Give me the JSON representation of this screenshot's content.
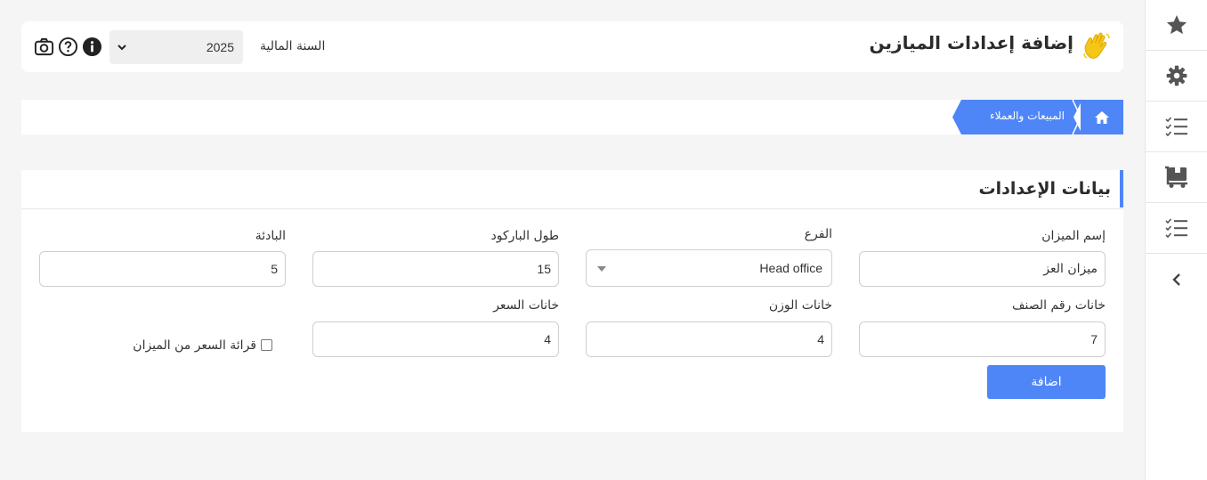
{
  "header": {
    "title": "إضافة إعدادات الميازين",
    "fiscal_year_label": "السنة المالية",
    "fiscal_year_value": "2025"
  },
  "breadcrumb": {
    "home_icon": "home-icon",
    "items": [
      "المبيعات والعملاء"
    ]
  },
  "sidebar": {
    "items": [
      {
        "icon": "star-icon"
      },
      {
        "icon": "gear-icon"
      },
      {
        "icon": "checklist-icon"
      },
      {
        "icon": "truck-icon"
      },
      {
        "icon": "checklist-icon"
      },
      {
        "icon": "chevron-left-icon"
      }
    ]
  },
  "form": {
    "section_title": "بيانات الإعدادات",
    "scale_name_label": "إسم الميزان",
    "scale_name_value": "ميزان العز",
    "branch_label": "الفرع",
    "branch_value": "Head office",
    "barcode_length_label": "طول الباركود",
    "barcode_length_value": "15",
    "prefix_label": "البادئة",
    "prefix_value": "5",
    "item_digits_label": "خانات رقم الصنف",
    "item_digits_value": "7",
    "weight_digits_label": "خانات الوزن",
    "weight_digits_value": "4",
    "price_digits_label": "خانات السعر",
    "price_digits_value": "4",
    "read_price_label": "قرائة السعر من الميزان",
    "read_price_checked": false,
    "submit_label": "اضافة"
  },
  "colors": {
    "accent": "#4f86f7",
    "background": "#f5f5f5"
  }
}
